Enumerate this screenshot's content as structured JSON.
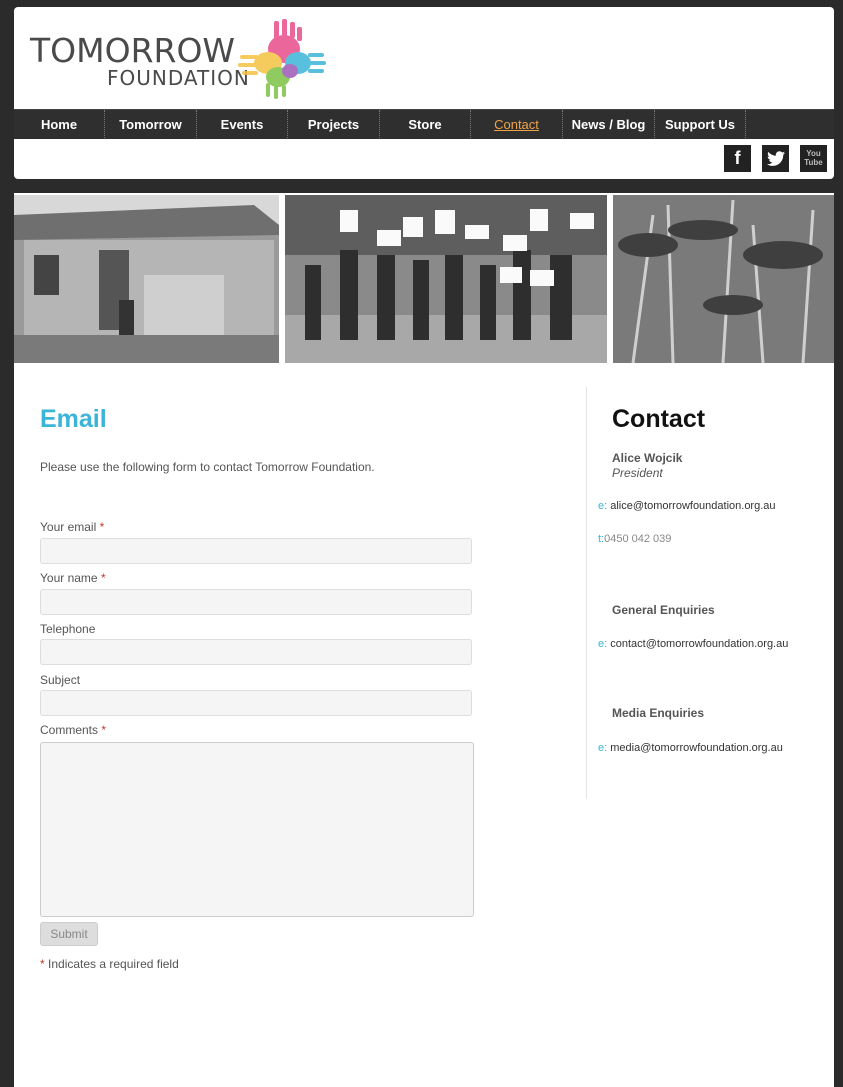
{
  "logo": {
    "line1": "TOMORROW",
    "line2": "FOUNDATION"
  },
  "nav": {
    "items": [
      {
        "label": "Home"
      },
      {
        "label": "Tomorrow"
      },
      {
        "label": "Events"
      },
      {
        "label": "Projects"
      },
      {
        "label": "Store"
      },
      {
        "label": "Contact"
      },
      {
        "label": "News / Blog"
      },
      {
        "label": "Support Us"
      }
    ]
  },
  "social": {
    "facebook": "f",
    "twitter": "t",
    "youtube": "You Tube"
  },
  "form": {
    "title": "Email",
    "intro": "Please use the following form to contact Tomorrow Foundation.",
    "email_label": "Your email",
    "name_label": "Your name",
    "telephone_label": "Telephone",
    "subject_label": "Subject",
    "comments_label": "Comments",
    "required_marker": "*",
    "submit_label": "Submit",
    "required_note": "Indicates a required field"
  },
  "contact": {
    "title": "Contact",
    "person_name": "Alice Wojcik",
    "person_role": "President",
    "email_prefix": "e:",
    "phone_prefix": "t:",
    "person_email": "alice@tomorrowfoundation.org.au",
    "person_phone": "0450 042 039",
    "general_heading": "General Enquiries",
    "general_email": "contact@tomorrowfoundation.org.au",
    "media_heading": "Media Enquiries",
    "media_email": "media@tomorrowfoundation.org.au"
  },
  "colors": {
    "accent": "#3cb4d8",
    "nav_active": "#f0a44a",
    "nav_bg": "#2f2f2f",
    "required": "#c0392b"
  },
  "icons": [
    "facebook-icon",
    "twitter-icon",
    "youtube-icon",
    "hands-logo-icon"
  ]
}
